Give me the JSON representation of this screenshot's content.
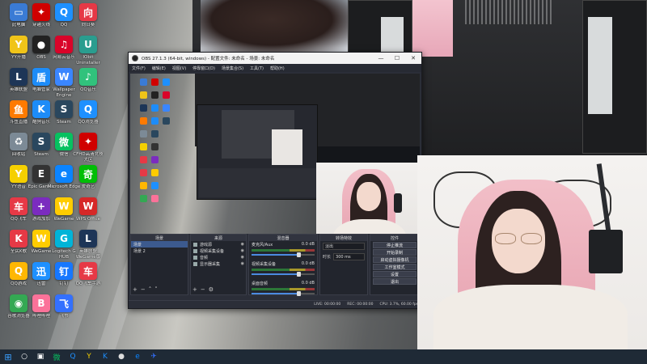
{
  "desktop": {
    "icons": [
      {
        "label": "此电脑",
        "color": "#3a7bd5",
        "glyph": "▭"
      },
      {
        "label": "YY开播",
        "color": "#f0c419",
        "glyph": "Y"
      },
      {
        "label": "英雄联盟",
        "color": "#1d3557",
        "glyph": "L"
      },
      {
        "label": "斗鱼直播",
        "color": "#ff7a00",
        "glyph": "鱼"
      },
      {
        "label": "回收站",
        "color": "#7c8a96",
        "glyph": "♻"
      },
      {
        "label": "YY语音",
        "color": "#f5d000",
        "glyph": "Y"
      },
      {
        "label": "QQ飞车",
        "color": "#e63946",
        "glyph": "车"
      },
      {
        "label": "全民K歌",
        "color": "#e63946",
        "glyph": "K"
      },
      {
        "label": "QQ游戏",
        "color": "#ffb703",
        "glyph": "Q"
      },
      {
        "label": "谷歌浏览器",
        "color": "#34a853",
        "glyph": "◉"
      },
      {
        "label": "穿越火线",
        "color": "#d00000",
        "glyph": "✦"
      },
      {
        "label": "OBS",
        "color": "#222222",
        "glyph": "●"
      },
      {
        "label": "电脑管家",
        "color": "#1d8cf8",
        "glyph": "盾"
      },
      {
        "label": "酷狗音乐",
        "color": "#1d8cf8",
        "glyph": "K"
      },
      {
        "label": "Steam",
        "color": "#2a475e",
        "glyph": "S"
      },
      {
        "label": "Epic Games",
        "color": "#333333",
        "glyph": "E"
      },
      {
        "label": "游戏加加",
        "color": "#7b2cbf",
        "glyph": "+"
      },
      {
        "label": "WeGame",
        "color": "#ffcc00",
        "glyph": "W"
      },
      {
        "label": "迅雷",
        "color": "#1e90ff",
        "glyph": "迅"
      },
      {
        "label": "哔哩哔哩",
        "color": "#fb7299",
        "glyph": "B"
      },
      {
        "label": "QQ",
        "color": "#1e90ff",
        "glyph": "Q"
      },
      {
        "label": "网易云音乐",
        "color": "#d90429",
        "glyph": "♫"
      },
      {
        "label": "Wallpaper Engine",
        "color": "#3a86ff",
        "glyph": "W"
      },
      {
        "label": "Steam",
        "color": "#2a475e",
        "glyph": "S"
      },
      {
        "label": "微信",
        "color": "#07c160",
        "glyph": "微"
      },
      {
        "label": "Microsoft Edge",
        "color": "#0a84ff",
        "glyph": "e"
      },
      {
        "label": "WeGame",
        "color": "#ffcc00",
        "glyph": "W"
      },
      {
        "label": "Logitech G HUB",
        "color": "#00b4d8",
        "glyph": "G"
      },
      {
        "label": "钉钉",
        "color": "#1677ff",
        "glyph": "钉"
      },
      {
        "label": "飞书",
        "color": "#3370ff",
        "glyph": "飞"
      },
      {
        "label": "向日葵",
        "color": "#e63946",
        "glyph": "向"
      },
      {
        "label": "IObit Uninstaller",
        "color": "#2a9d8f",
        "glyph": "U"
      },
      {
        "label": "QQ音乐",
        "color": "#31c27c",
        "glyph": "♪"
      },
      {
        "label": "QQ浏览器",
        "color": "#1e90ff",
        "glyph": "Q"
      },
      {
        "label": "CFHD高清竞技大区",
        "color": "#d00000",
        "glyph": "✦"
      },
      {
        "label": "爱奇艺",
        "color": "#00be06",
        "glyph": "奇"
      },
      {
        "label": "WPS Office",
        "color": "#d62828",
        "glyph": "W"
      },
      {
        "label": "英雄联盟WeGame版",
        "color": "#1d3557",
        "glyph": "L"
      },
      {
        "label": "QQ飞车手游",
        "color": "#e63946",
        "glyph": "车"
      }
    ]
  },
  "obs": {
    "title": "OBS 27.1.3 (64-bit, windows) - 配置文件: 未命名 - 场景: 未命名",
    "menu": [
      "文件(F)",
      "编辑(E)",
      "视图(V)",
      "停靠窗口(D)",
      "场景集合(S)",
      "工具(T)",
      "帮助(H)"
    ],
    "docks": {
      "scenes": {
        "title": "场景",
        "items": [
          "场景",
          "场景 2"
        ]
      },
      "sources": {
        "title": "来源",
        "items": [
          "游戏源",
          "视频采集设备",
          "音频",
          "显示器采集"
        ]
      },
      "mixer": {
        "title": "混音器",
        "channels": [
          {
            "name": "麦克风/Aux",
            "db": "0.0 dB",
            "level": 0.72
          },
          {
            "name": "视频采集设备",
            "db": "0.0 dB",
            "level": 0.72
          },
          {
            "name": "桌面音频",
            "db": "0.0 dB",
            "level": 0.72
          }
        ]
      },
      "transitions": {
        "title": "转场特效",
        "type": "淡出",
        "duration_label": "时长",
        "duration": "300 ms"
      },
      "controls": {
        "title": "控件",
        "buttons": [
          "停止推流",
          "开始录制",
          "启动虚拟摄像机",
          "工作室模式",
          "设置",
          "退出"
        ]
      }
    },
    "status": {
      "live": "LIVE: 00:00:00",
      "rec": "REC: 00:00:00",
      "cpu": "CPU: 3.7%, 60.00 fps"
    }
  },
  "taskbar": {
    "items": [
      {
        "name": "start",
        "glyph": "⊞",
        "color": "#3aa0ff"
      },
      {
        "name": "search",
        "glyph": "○",
        "color": "#ffffff"
      },
      {
        "name": "task-view",
        "glyph": "▣",
        "color": "#ffffff"
      },
      {
        "name": "wechat",
        "glyph": "微",
        "color": "#07c160"
      },
      {
        "name": "qq",
        "glyph": "Q",
        "color": "#1e90ff"
      },
      {
        "name": "yy",
        "glyph": "Y",
        "color": "#f5d000"
      },
      {
        "name": "kugou",
        "glyph": "K",
        "color": "#1d8cf8"
      },
      {
        "name": "obs",
        "glyph": "●",
        "color": "#dddddd"
      },
      {
        "name": "edge",
        "glyph": "e",
        "color": "#0a84ff"
      },
      {
        "name": "feishu",
        "glyph": "✈",
        "color": "#3370ff"
      }
    ]
  }
}
